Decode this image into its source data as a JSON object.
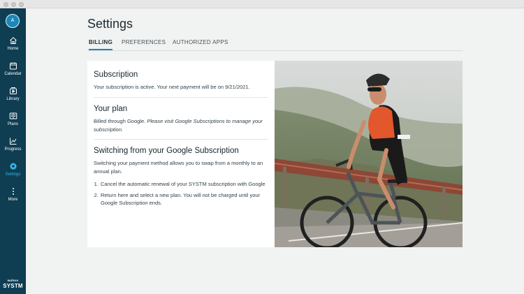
{
  "window": {
    "traffic_lights": [
      "close",
      "minimize",
      "zoom"
    ]
  },
  "sidebar": {
    "avatar_initial": "A",
    "items": [
      {
        "label": "Home",
        "icon": "home-icon",
        "active": false
      },
      {
        "label": "Calendar",
        "icon": "calendar-icon",
        "active": false
      },
      {
        "label": "Library",
        "icon": "library-icon",
        "active": false
      },
      {
        "label": "Plans",
        "icon": "plans-icon",
        "active": false
      },
      {
        "label": "Progress",
        "icon": "progress-icon",
        "active": false
      },
      {
        "label": "Settings",
        "icon": "gear-icon",
        "active": true
      },
      {
        "label": "More",
        "icon": "more-icon",
        "active": false
      }
    ],
    "brand_small": "wahoo",
    "brand_big": "SYSTM"
  },
  "page": {
    "title": "Settings",
    "tabs": [
      {
        "label": "BILLING",
        "active": true
      },
      {
        "label": "PREFERENCES",
        "active": false
      },
      {
        "label": "AUTHORIZED APPS",
        "active": false
      }
    ]
  },
  "billing": {
    "subscription": {
      "heading": "Subscription",
      "text": "Your subscription is active. Your next payment will be on 9/21/2021."
    },
    "plan": {
      "heading": "Your plan",
      "text": "Billed through Google.",
      "note": "Please visit Google Subscriptions to manage your subscription."
    },
    "switching": {
      "heading": "Switching from your Google Subscription",
      "text": "Switching your payment method allows you to swap from a monthly to an annual plan.",
      "steps": [
        "Cancel the automatic renewal of your SYSTM subscription with Google",
        "Return here and select a new plan. You will not be charged until your Google Subscription ends."
      ]
    },
    "photo": {
      "subject": "cyclist-photo",
      "jersey_text": "RAPHA"
    }
  },
  "colors": {
    "sidebar_bg": "#0f3d52",
    "accent": "#1b87b9",
    "active_nav": "#39b5e9",
    "page_bg": "#f1f2f2"
  }
}
